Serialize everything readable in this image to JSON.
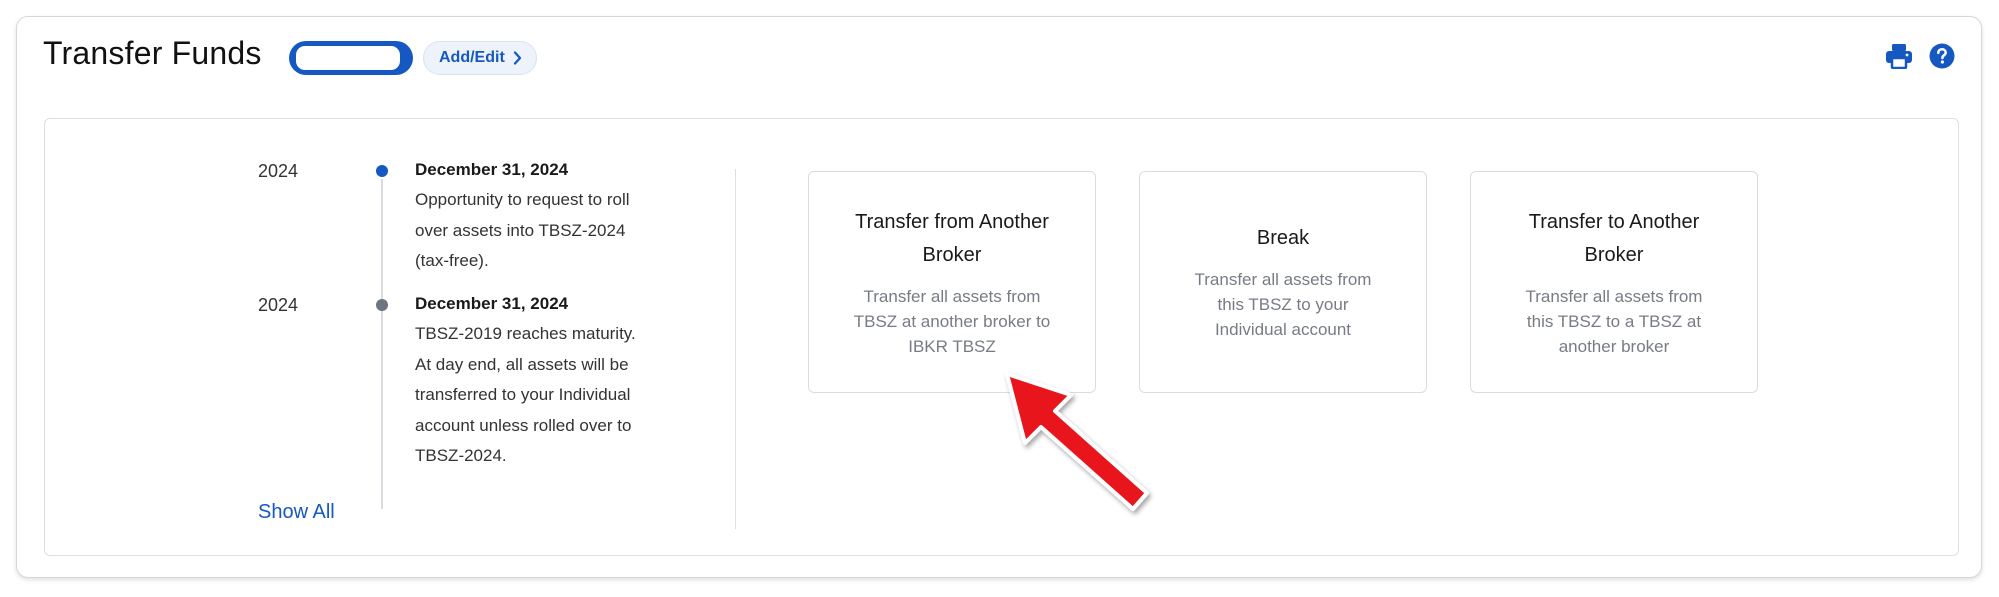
{
  "header": {
    "title": "Transfer Funds",
    "add_edit_label": "Add/Edit",
    "icons": [
      "printer-icon",
      "help-icon"
    ]
  },
  "timeline": {
    "events": [
      {
        "year": "2024",
        "date": "December 31, 2024",
        "description_lines": [
          "Opportunity to request to roll",
          "over assets into TBSZ-2024",
          "(tax-free)."
        ],
        "status": "upcoming"
      },
      {
        "year": "2024",
        "date": "December 31, 2024",
        "description_lines": [
          "TBSZ-2019 reaches maturity.",
          "At day end, all assets will be",
          "transferred to your Individual",
          "account unless rolled over to",
          "TBSZ-2024."
        ],
        "status": "past"
      }
    ],
    "show_all_label": "Show All"
  },
  "actions": [
    {
      "title_lines": [
        "Transfer from Another",
        "Broker"
      ],
      "description_lines": [
        "Transfer all assets from",
        "TBSZ at another broker to",
        "IBKR TBSZ"
      ]
    },
    {
      "title_lines": [
        "Break"
      ],
      "description_lines": [
        "Transfer all assets from",
        "this TBSZ to your",
        "Individual account"
      ]
    },
    {
      "title_lines": [
        "Transfer to Another",
        "Broker"
      ],
      "description_lines": [
        "Transfer all assets from",
        "this TBSZ to a TBSZ at",
        "another broker"
      ]
    }
  ],
  "colors": {
    "accent": "#1558c2",
    "arrow": "#e8131b",
    "muted_text": "#777c84"
  }
}
